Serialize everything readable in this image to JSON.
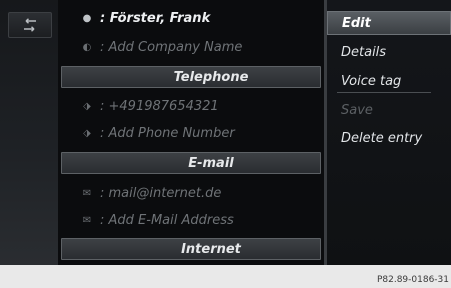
{
  "contact": {
    "rows": [
      {
        "icon": "person",
        "text": ": Förster, Frank",
        "type": "field",
        "selected": true
      },
      {
        "icon": "company",
        "text": ": Add Company Name",
        "type": "field"
      },
      {
        "text": "Telephone",
        "type": "header"
      },
      {
        "icon": "phone",
        "text": ": +491987654321",
        "type": "field"
      },
      {
        "icon": "phone",
        "text": ": Add Phone Number",
        "type": "field"
      },
      {
        "text": "E-mail",
        "type": "header"
      },
      {
        "icon": "email",
        "text": ": mail@internet.de",
        "type": "field"
      },
      {
        "icon": "email",
        "text": ": Add E-Mail Address",
        "type": "field"
      },
      {
        "text": "Internet",
        "type": "header"
      }
    ]
  },
  "menu": {
    "items": [
      {
        "label": "Edit",
        "active": true
      },
      {
        "label": "Details"
      },
      {
        "label": "Voice tag"
      },
      {
        "label": "Save",
        "disabled": true
      },
      {
        "label": "Delete entry"
      }
    ]
  },
  "caption": "P82.89-0186-31"
}
